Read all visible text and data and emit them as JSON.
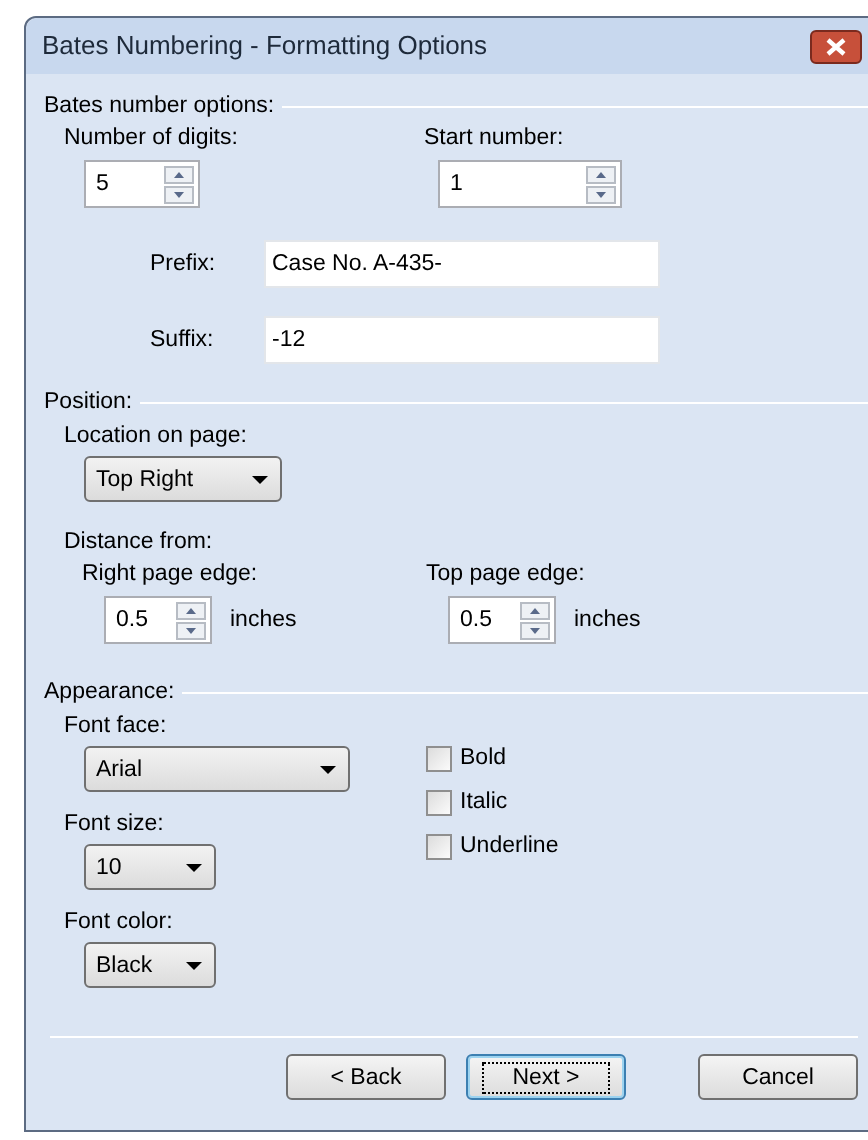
{
  "window": {
    "title": "Bates Numbering - Formatting Options"
  },
  "bates_options": {
    "heading": "Bates number options:",
    "digits": {
      "label": "Number of digits:",
      "value": "5"
    },
    "start": {
      "label": "Start number:",
      "value": "1"
    },
    "prefix": {
      "label": "Prefix:",
      "value": "Case No. A-435-"
    },
    "suffix": {
      "label": "Suffix:",
      "value": "-12"
    }
  },
  "position": {
    "heading": "Position:",
    "location": {
      "label": "Location on page:",
      "value": "Top Right"
    },
    "distance_label": "Distance from:",
    "right_edge": {
      "label": "Right page edge:",
      "value": "0.5",
      "unit": "inches"
    },
    "top_edge": {
      "label": "Top page edge:",
      "value": "0.5",
      "unit": "inches"
    }
  },
  "appearance": {
    "heading": "Appearance:",
    "font_face": {
      "label": "Font face:",
      "value": "Arial"
    },
    "font_size": {
      "label": "Font size:",
      "value": "10"
    },
    "font_color": {
      "label": "Font color:",
      "value": "Black"
    },
    "styles": [
      {
        "label": "Bold",
        "checked": false
      },
      {
        "label": "Italic",
        "checked": false
      },
      {
        "label": "Underline",
        "checked": false
      }
    ]
  },
  "buttons": [
    {
      "label": "< Back",
      "focused": false
    },
    {
      "label": "Next >",
      "focused": true
    },
    {
      "label": "Cancel",
      "focused": false
    }
  ]
}
